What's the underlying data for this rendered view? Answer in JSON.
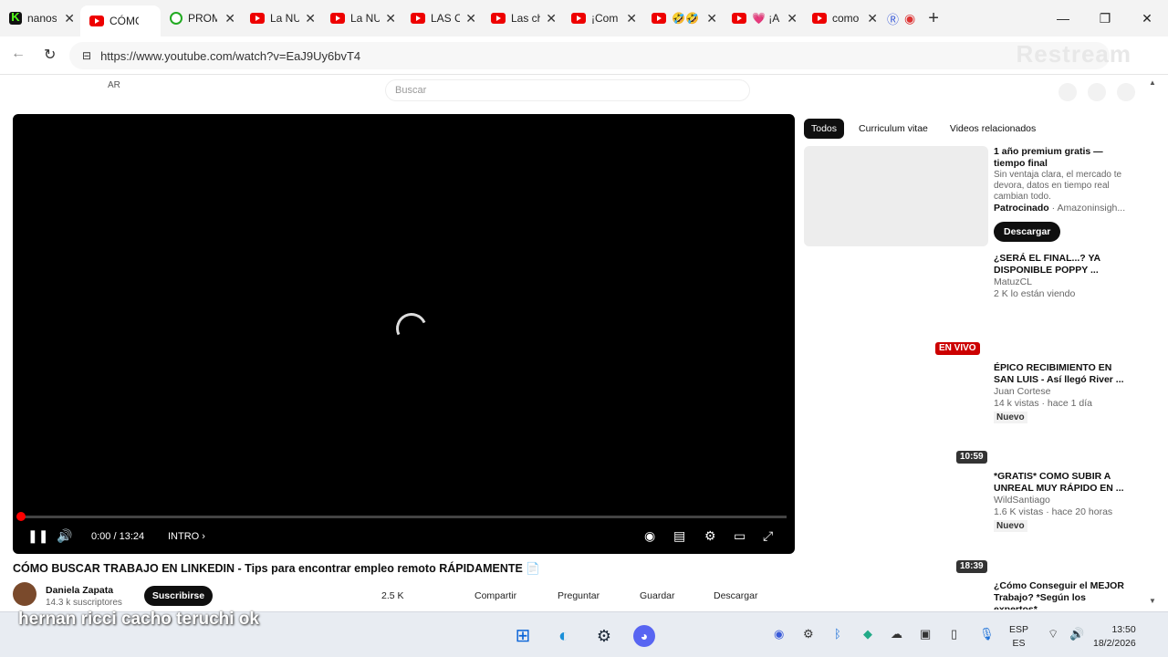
{
  "browser": {
    "tabs": [
      {
        "title": "nanos",
        "icon": "kick-icon"
      },
      {
        "title": "CÓMO",
        "icon": "youtube-icon",
        "active": true
      },
      {
        "title": "PROM",
        "icon": "football-icon"
      },
      {
        "title": "La NU",
        "icon": "youtube-icon"
      },
      {
        "title": "La NU",
        "icon": "youtube-icon"
      },
      {
        "title": "LAS C",
        "icon": "youtube-icon"
      },
      {
        "title": "Las ch",
        "icon": "youtube-icon"
      },
      {
        "title": "¡Com",
        "icon": "youtube-icon"
      },
      {
        "title": "🤣🤣",
        "icon": "youtube-icon"
      },
      {
        "title": "💗 ¡A",
        "icon": "youtube-icon"
      },
      {
        "title": "como",
        "icon": "youtube-icon"
      }
    ],
    "url": "https://www.youtube.com/watch?v=EaJ9Uy6bvT4",
    "watermark": "Restream"
  },
  "youtube": {
    "country": "AR",
    "search_placeholder": "Buscar",
    "player": {
      "time": "0:00 / 13:24",
      "chapter": "INTRO",
      "progress_fraction": 0.0
    },
    "video_title": "CÓMO BUSCAR TRABAJO EN LINKEDIN - Tips para encontrar empleo remoto RÁPIDAMENTE 📄",
    "channel": {
      "name": "Daniela Zapata",
      "subs": "14.3 k suscriptores",
      "subscribe": "Suscribirse"
    },
    "actions": {
      "likes": "2.5 K",
      "share": "Compartir",
      "ask": "Preguntar",
      "save": "Guardar",
      "download": "Descargar"
    },
    "chips": [
      "Todos",
      "Curriculum vitae",
      "Videos relacionados"
    ],
    "ad": {
      "title": "1 año premium gratis — tiempo final",
      "desc": "Sin ventaja clara, el mercado te devora, datos en tiempo real cambian todo.",
      "sponsor_label": "Patrocinado",
      "sponsor": " · Amazoninsigh...",
      "button": "Descargar"
    },
    "recommendations": [
      {
        "title": "¿SERÁ EL FINAL...? YA DISPONIBLE POPPY ...",
        "channel": "MatuzCL",
        "meta": "2 K lo están viendo"
      },
      {
        "badge": "EN VIVO",
        "title": "ÉPICO RECIBIMIENTO EN SAN LUIS - Así llegó River ...",
        "channel": "Juan Cortese",
        "meta": "14 k vistas · hace 1 día",
        "tag": "Nuevo"
      },
      {
        "badge": "10:59",
        "title": "*GRATIS* COMO SUBIR A UNREAL MUY RÁPIDO EN ...",
        "channel": "WildSantiago",
        "meta": "1.6 K vistas · hace 20 horas",
        "tag": "Nuevo"
      },
      {
        "badge": "18:39",
        "title": "¿Cómo Conseguir el MEJOR Trabajo? *Según los expertos*"
      }
    ]
  },
  "overlay_text": "hernan ricci cacho teruchi ok",
  "taskbar": {
    "lang1": "ESP",
    "lang2": "ES",
    "time": "13:50",
    "date": "18/2/2026"
  }
}
